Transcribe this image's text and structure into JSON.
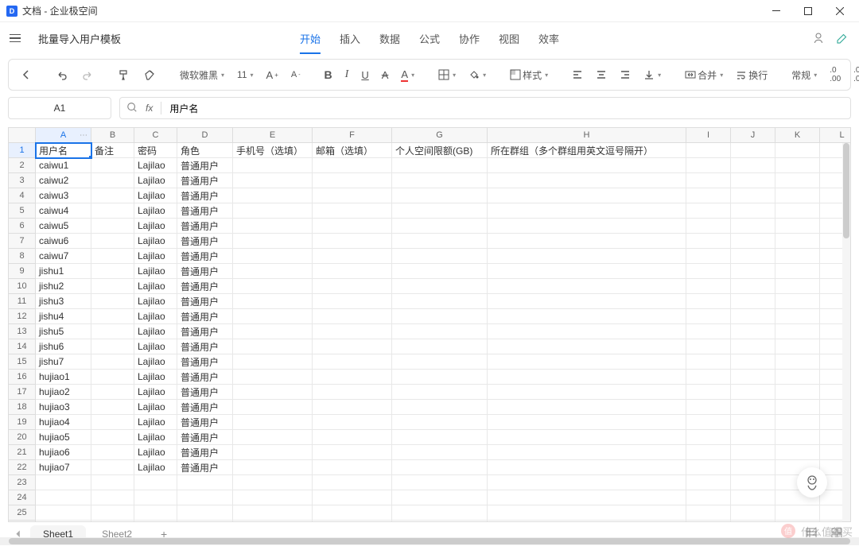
{
  "window": {
    "title": "文档 - 企业极空间"
  },
  "doc": {
    "title": "批量导入用户模板"
  },
  "tabs": [
    "开始",
    "插入",
    "数据",
    "公式",
    "协作",
    "视图",
    "效率"
  ],
  "activeTabIndex": 0,
  "toolbar": {
    "font": "微软雅黑",
    "fontSize": "11",
    "styleLabel": "样式",
    "mergeLabel": "合并",
    "wrapLabel": "换行",
    "formatLabel": "常规"
  },
  "formulaBar": {
    "nameBox": "A1",
    "fx": "fx",
    "value": "用户名"
  },
  "columns": [
    "A",
    "B",
    "C",
    "D",
    "E",
    "F",
    "G",
    "H",
    "I",
    "J",
    "K",
    "L"
  ],
  "headerRow": [
    "用户名",
    "备注",
    "密码",
    "角色",
    "手机号（选填）",
    "邮箱（选填）",
    "个人空间限额(GB)",
    "所在群组（多个群组用英文逗号隔开）",
    "",
    "",
    "",
    ""
  ],
  "dataRows": [
    [
      "caiwu1",
      "",
      "Lajilao",
      "普通用户",
      "",
      "",
      "",
      "",
      "",
      "",
      "",
      ""
    ],
    [
      "caiwu2",
      "",
      "Lajilao",
      "普通用户",
      "",
      "",
      "",
      "",
      "",
      "",
      "",
      ""
    ],
    [
      "caiwu3",
      "",
      "Lajilao",
      "普通用户",
      "",
      "",
      "",
      "",
      "",
      "",
      "",
      ""
    ],
    [
      "caiwu4",
      "",
      "Lajilao",
      "普通用户",
      "",
      "",
      "",
      "",
      "",
      "",
      "",
      ""
    ],
    [
      "caiwu5",
      "",
      "Lajilao",
      "普通用户",
      "",
      "",
      "",
      "",
      "",
      "",
      "",
      ""
    ],
    [
      "caiwu6",
      "",
      "Lajilao",
      "普通用户",
      "",
      "",
      "",
      "",
      "",
      "",
      "",
      ""
    ],
    [
      "caiwu7",
      "",
      "Lajilao",
      "普通用户",
      "",
      "",
      "",
      "",
      "",
      "",
      "",
      ""
    ],
    [
      "jishu1",
      "",
      "Lajilao",
      "普通用户",
      "",
      "",
      "",
      "",
      "",
      "",
      "",
      ""
    ],
    [
      "jishu2",
      "",
      "Lajilao",
      "普通用户",
      "",
      "",
      "",
      "",
      "",
      "",
      "",
      ""
    ],
    [
      "jishu3",
      "",
      "Lajilao",
      "普通用户",
      "",
      "",
      "",
      "",
      "",
      "",
      "",
      ""
    ],
    [
      "jishu4",
      "",
      "Lajilao",
      "普通用户",
      "",
      "",
      "",
      "",
      "",
      "",
      "",
      ""
    ],
    [
      "jishu5",
      "",
      "Lajilao",
      "普通用户",
      "",
      "",
      "",
      "",
      "",
      "",
      "",
      ""
    ],
    [
      "jishu6",
      "",
      "Lajilao",
      "普通用户",
      "",
      "",
      "",
      "",
      "",
      "",
      "",
      ""
    ],
    [
      "jishu7",
      "",
      "Lajilao",
      "普通用户",
      "",
      "",
      "",
      "",
      "",
      "",
      "",
      ""
    ],
    [
      "hujiao1",
      "",
      "Lajilao",
      "普通用户",
      "",
      "",
      "",
      "",
      "",
      "",
      "",
      ""
    ],
    [
      "hujiao2",
      "",
      "Lajilao",
      "普通用户",
      "",
      "",
      "",
      "",
      "",
      "",
      "",
      ""
    ],
    [
      "hujiao3",
      "",
      "Lajilao",
      "普通用户",
      "",
      "",
      "",
      "",
      "",
      "",
      "",
      ""
    ],
    [
      "hujiao4",
      "",
      "Lajilao",
      "普通用户",
      "",
      "",
      "",
      "",
      "",
      "",
      "",
      ""
    ],
    [
      "hujiao5",
      "",
      "Lajilao",
      "普通用户",
      "",
      "",
      "",
      "",
      "",
      "",
      "",
      ""
    ],
    [
      "hujiao6",
      "",
      "Lajilao",
      "普通用户",
      "",
      "",
      "",
      "",
      "",
      "",
      "",
      ""
    ],
    [
      "hujiao7",
      "",
      "Lajilao",
      "普通用户",
      "",
      "",
      "",
      "",
      "",
      "",
      "",
      ""
    ],
    [
      "",
      "",
      "",
      "",
      "",
      "",
      "",
      "",
      "",
      "",
      "",
      ""
    ],
    [
      "",
      "",
      "",
      "",
      "",
      "",
      "",
      "",
      "",
      "",
      "",
      ""
    ],
    [
      "",
      "",
      "",
      "",
      "",
      "",
      "",
      "",
      "",
      "",
      "",
      ""
    ],
    [
      "",
      "",
      "",
      "",
      "",
      "",
      "",
      "",
      "",
      "",
      "",
      ""
    ]
  ],
  "selectedCell": {
    "row": 1,
    "col": 0
  },
  "sheetTabs": [
    "Sheet1",
    "Sheet2"
  ],
  "activeSheetIndex": 0,
  "watermark": "什么值得买"
}
